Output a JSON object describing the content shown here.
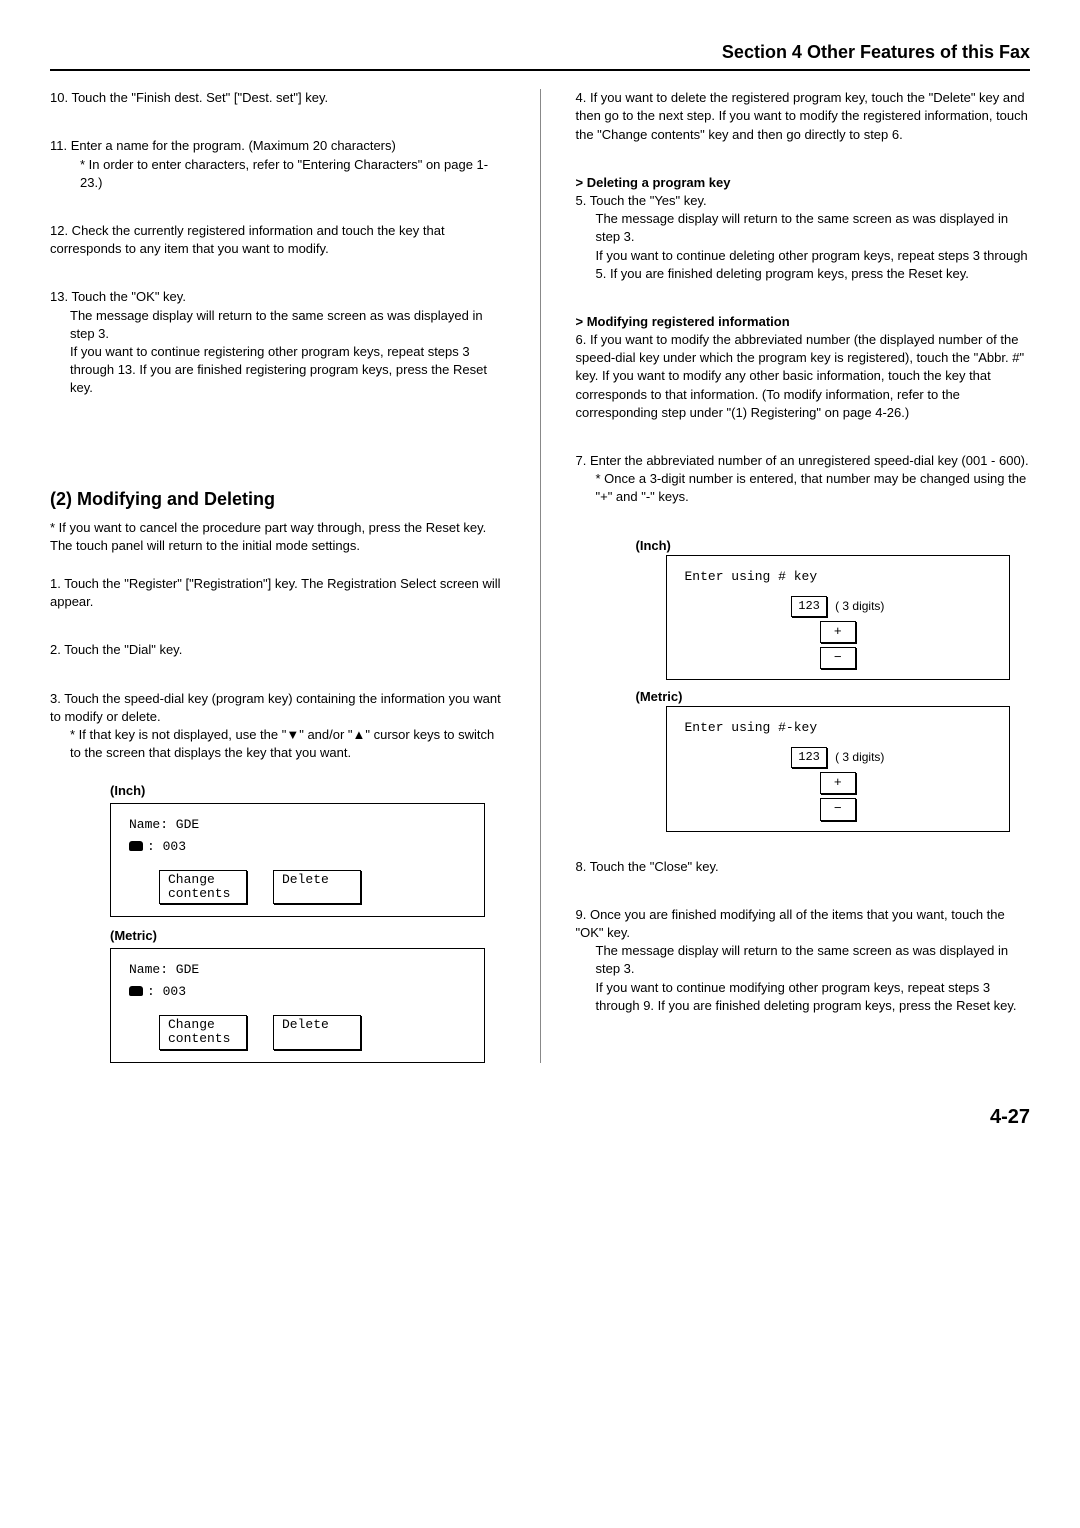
{
  "header": "Section 4 Other Features of this Fax",
  "left": {
    "p10": "10. Touch the \"Finish dest. Set\" [\"Dest. set\"] key.",
    "p11": "11. Enter a name for the program. (Maximum 20 characters)",
    "p11note": "* In order to enter characters, refer to \"Entering Characters\" on page 1-23.)",
    "p12": "12. Check the currently registered information and touch the key that corresponds to any item that you want to modify.",
    "p13a": "13. Touch the \"OK\" key.",
    "p13b": "The message display will return to the same screen as was displayed in step 3.",
    "p13c": "If you want to continue registering other program keys, repeat steps 3 through 13. If you are finished registering program keys, press the Reset key.",
    "sec2title": "(2) Modifying and Deleting",
    "sec2note": "* If you want to cancel the procedure part way through, press the Reset key. The touch panel will return to the initial mode settings.",
    "s1": "1. Touch the \"Register\" [\"Registration\"] key. The Registration Select screen will appear.",
    "s2": "2. Touch the \"Dial\" key.",
    "s3a": "3. Touch the speed-dial key (program key) containing the information you want to modify or delete.",
    "s3b": "* If that key is not displayed, use the \"▼\" and/or \"▲\" cursor keys to switch to the screen that displays the key that you want.",
    "panel": {
      "inchLabel": "(Inch)",
      "metricLabel": "(Metric)",
      "name": "Name: GDE",
      "tel": ": 003",
      "change": "Change\ncontents",
      "delete": "Delete"
    }
  },
  "right": {
    "p4": "4. If you want to delete the registered program key, touch the \"Delete\" key and then go to the next step. If you want to modify the registered information, touch the \"Change contents\" key and then go directly to step 6.",
    "delHead": "> Deleting a program key",
    "p5a": "5. Touch the \"Yes\" key.",
    "p5b": "The message display will return to the same screen as was displayed in step 3.",
    "p5c": "If you want to continue deleting other program keys, repeat steps 3 through 5. If you are finished deleting program keys, press the Reset key.",
    "modHead": "> Modifying registered information",
    "p6": "6. If you want to modify the abbreviated number (the displayed number of the speed-dial key under which the program key is registered), touch the \"Abbr. #\" key. If you want to modify any other basic information, touch the key that corresponds to that information. (To modify information, refer to the corresponding step under \"(1) Registering\" on page 4-26.)",
    "p7a": "7. Enter the abbreviated number of an unregistered speed-dial key (001 - 600).",
    "p7b": "* Once a 3-digit number is entered, that number may be changed using the \"+\" and \"-\" keys.",
    "panel2": {
      "inchLabel": "(Inch)",
      "metricLabel": "(Metric)",
      "lineInch": "Enter using # key",
      "lineMetric": "Enter using #-key",
      "num": "123",
      "digits": "( 3 digits)",
      "plus": "+",
      "minus": "−"
    },
    "p8": "8. Touch the \"Close\" key.",
    "p9a": "9. Once you are finished modifying all of the items that you want, touch the \"OK\" key.",
    "p9b": "The message display will return to the same screen as was displayed in step 3.",
    "p9c": "If you want to continue modifying other program keys, repeat steps 3 through 9. If you are finished deleting program keys, press the Reset key."
  },
  "pageNum": "4-27"
}
